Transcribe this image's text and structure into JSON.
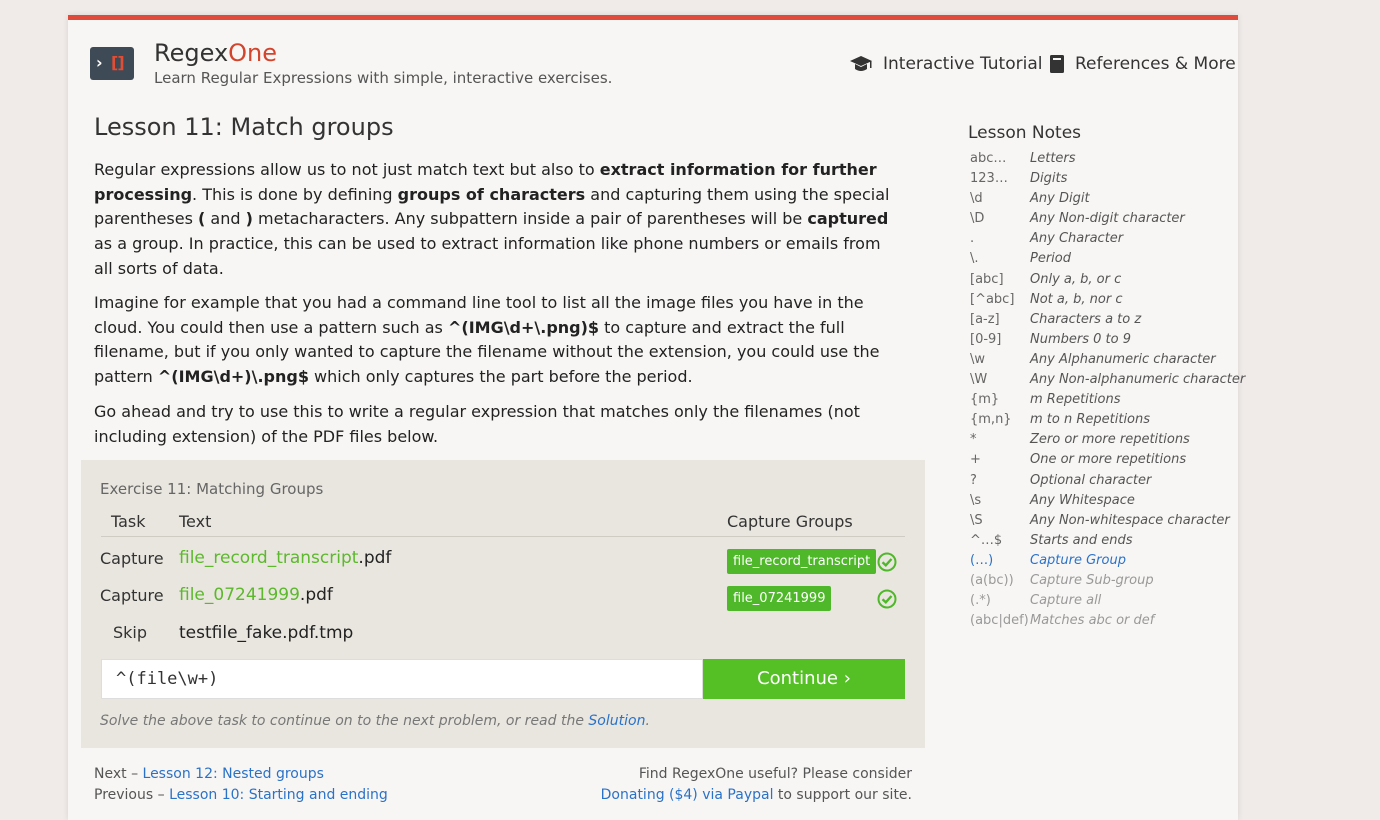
{
  "header": {
    "brand_regex": "Regex",
    "brand_one": "One",
    "tagline": "Learn Regular Expressions with simple, interactive exercises.",
    "nav": {
      "tutorial": "Interactive Tutorial",
      "references": "References & More"
    }
  },
  "lesson": {
    "title": "Lesson 11: Match groups",
    "p1": [
      "Regular expressions allow us to not just match text but also to ",
      "extract information for further processing",
      ". This is done by defining ",
      "groups of characters",
      " and capturing them using the special parentheses ",
      "(",
      " and ",
      ")",
      " metacharacters. Any subpattern inside a pair of parentheses will be ",
      "captured",
      " as a group. In practice, this can be used to extract information like phone numbers or emails from all sorts of data."
    ],
    "p2": [
      "Imagine for example that you had a command line tool to list all the image files you have in the cloud. You could then use a pattern such as ",
      "^(IMG\\d+\\.png)$",
      " to capture and extract the full filename, but if you only wanted to capture the filename without the extension, you could use the pattern ",
      "^(IMG\\d+)\\.png$",
      " which only captures the part before the period."
    ],
    "p3": "Go ahead and try to use this to write a regular expression that matches only the filenames (not including extension) of the PDF files below."
  },
  "exercise": {
    "title": "Exercise 11: Matching Groups",
    "headers": {
      "task": "Task",
      "text": "Text",
      "groups": "Capture Groups"
    },
    "rows": [
      {
        "task": "Capture",
        "match": "file_record_transcript",
        "rest": ".pdf",
        "group": "file_record_transcript",
        "status": "check-icon"
      },
      {
        "task": "Capture",
        "match": "file_07241999",
        "rest": ".pdf",
        "group": "file_07241999",
        "status": "check-icon"
      },
      {
        "task": "Skip",
        "match": "",
        "rest": "testfile_fake.pdf.tmp",
        "group": "",
        "status": ""
      }
    ],
    "input_value": "^(file\\w+)",
    "continue_label": "Continue ›",
    "hint_prefix": "Solve the above task to continue on to the next problem, or read the ",
    "hint_link": "Solution",
    "hint_suffix": "."
  },
  "footer": {
    "next_prefix": "Next – ",
    "next_link": "Lesson 12: Nested groups",
    "prev_prefix": "Previous – ",
    "prev_link": "Lesson 10: Starting and ending",
    "useful": "Find RegexOne useful? Please consider",
    "donate_link": "Donating ($4) via Paypal",
    "donate_suffix": " to support our site."
  },
  "notes": {
    "title": "Lesson Notes",
    "items": [
      {
        "k": "abc…",
        "v": "Letters"
      },
      {
        "k": "123…",
        "v": "Digits"
      },
      {
        "k": "\\d",
        "v": "Any Digit"
      },
      {
        "k": "\\D",
        "v": "Any Non-digit character"
      },
      {
        "k": ".",
        "v": "Any Character"
      },
      {
        "k": "\\.",
        "v": "Period"
      },
      {
        "k": "[abc]",
        "v": "Only a, b, or c"
      },
      {
        "k": "[^abc]",
        "v": "Not a, b, nor c"
      },
      {
        "k": "[a-z]",
        "v": "Characters a to z"
      },
      {
        "k": "[0-9]",
        "v": "Numbers 0 to 9"
      },
      {
        "k": "\\w",
        "v": "Any Alphanumeric character"
      },
      {
        "k": "\\W",
        "v": "Any Non-alphanumeric character"
      },
      {
        "k": "{m}",
        "v": "m Repetitions"
      },
      {
        "k": "{m,n}",
        "v": "m to n Repetitions"
      },
      {
        "k": "*",
        "v": "Zero or more repetitions"
      },
      {
        "k": "+",
        "v": "One or more repetitions"
      },
      {
        "k": "?",
        "v": "Optional character"
      },
      {
        "k": "\\s",
        "v": "Any Whitespace"
      },
      {
        "k": "\\S",
        "v": "Any Non-whitespace character"
      },
      {
        "k": "^…$",
        "v": "Starts and ends"
      },
      {
        "k": "(…)",
        "v": "Capture Group",
        "state": "selected"
      },
      {
        "k": "(a(bc))",
        "v": "Capture Sub-group",
        "state": "dim"
      },
      {
        "k": "(.*)",
        "v": "Capture all",
        "state": "dim"
      },
      {
        "k": "(abc|def)",
        "v": "Matches abc or def",
        "state": "dim"
      }
    ]
  },
  "colors": {
    "accent": "#e04a3a",
    "match": "#5cb82c",
    "button": "#55c026",
    "link": "#2a72c8"
  }
}
